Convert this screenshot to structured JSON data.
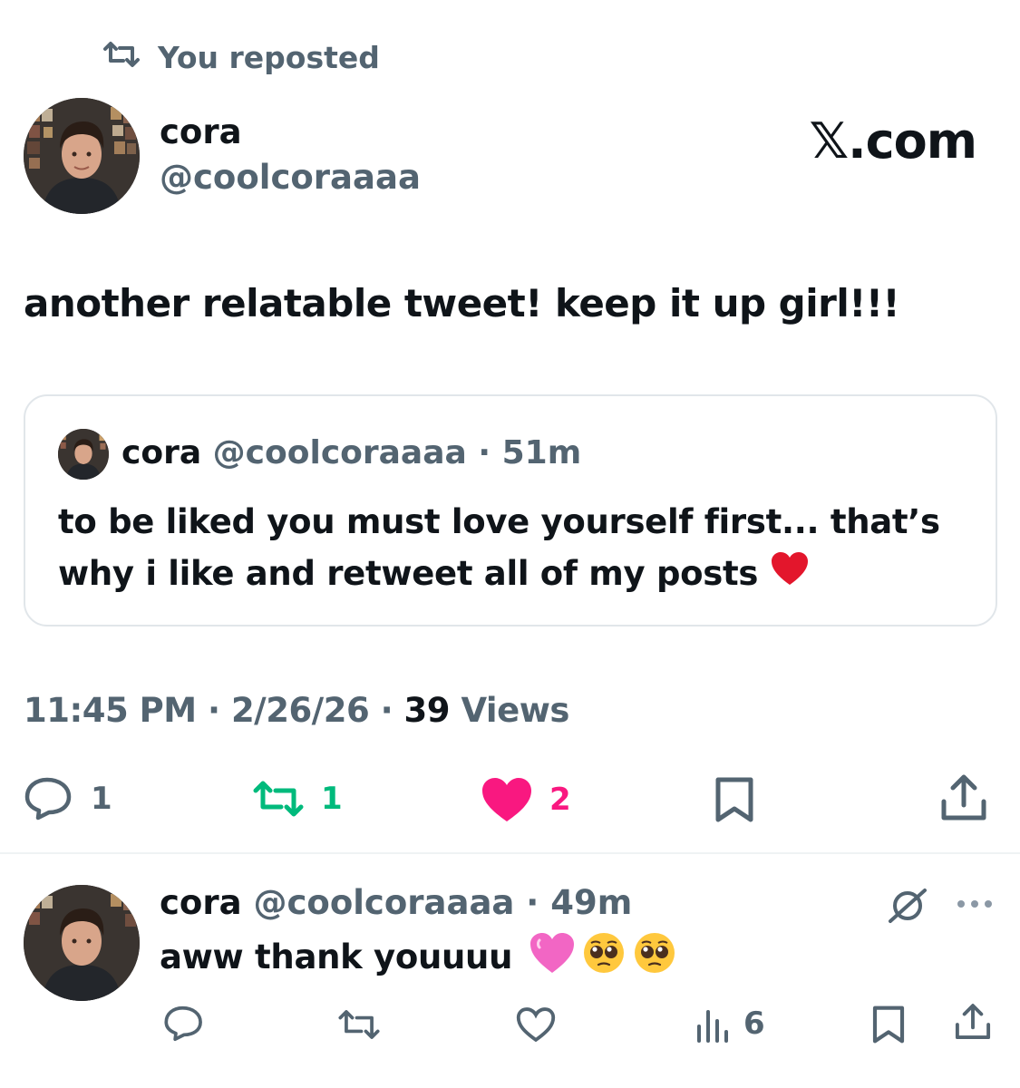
{
  "repost_banner": {
    "icon": "repost-icon",
    "text": "You reposted"
  },
  "post": {
    "author_name": "cora",
    "author_handle": "@coolcoraaaa",
    "site_logo": "𝕏.com",
    "text": "another relatable tweet! keep it up girl!!!",
    "quote": {
      "author_name": "cora",
      "author_handle": "@coolcoraaaa",
      "separator": "·",
      "time_ago": "51m",
      "text": "to be liked you must love yourself first... that’s why i like and retweet all of my posts",
      "emoji": "red-heart"
    },
    "meta": {
      "time": "11:45 PM",
      "separator": "·",
      "date": "2/26/26",
      "views_count": "39",
      "views_label": "Views"
    },
    "actions": {
      "reply_count": "1",
      "repost_count": "1",
      "like_count": "2",
      "colors": {
        "repost": "#00ba7c",
        "like": "#f91880",
        "icon": "#536471"
      }
    }
  },
  "reply": {
    "author_name": "cora",
    "author_handle": "@coolcoraaaa",
    "separator": "·",
    "time_ago": "49m",
    "text": "aww thank youuuu",
    "emojis": [
      "pink-heart",
      "pleading-face",
      "pleading-face"
    ],
    "actions": {
      "views_count": "6"
    }
  }
}
